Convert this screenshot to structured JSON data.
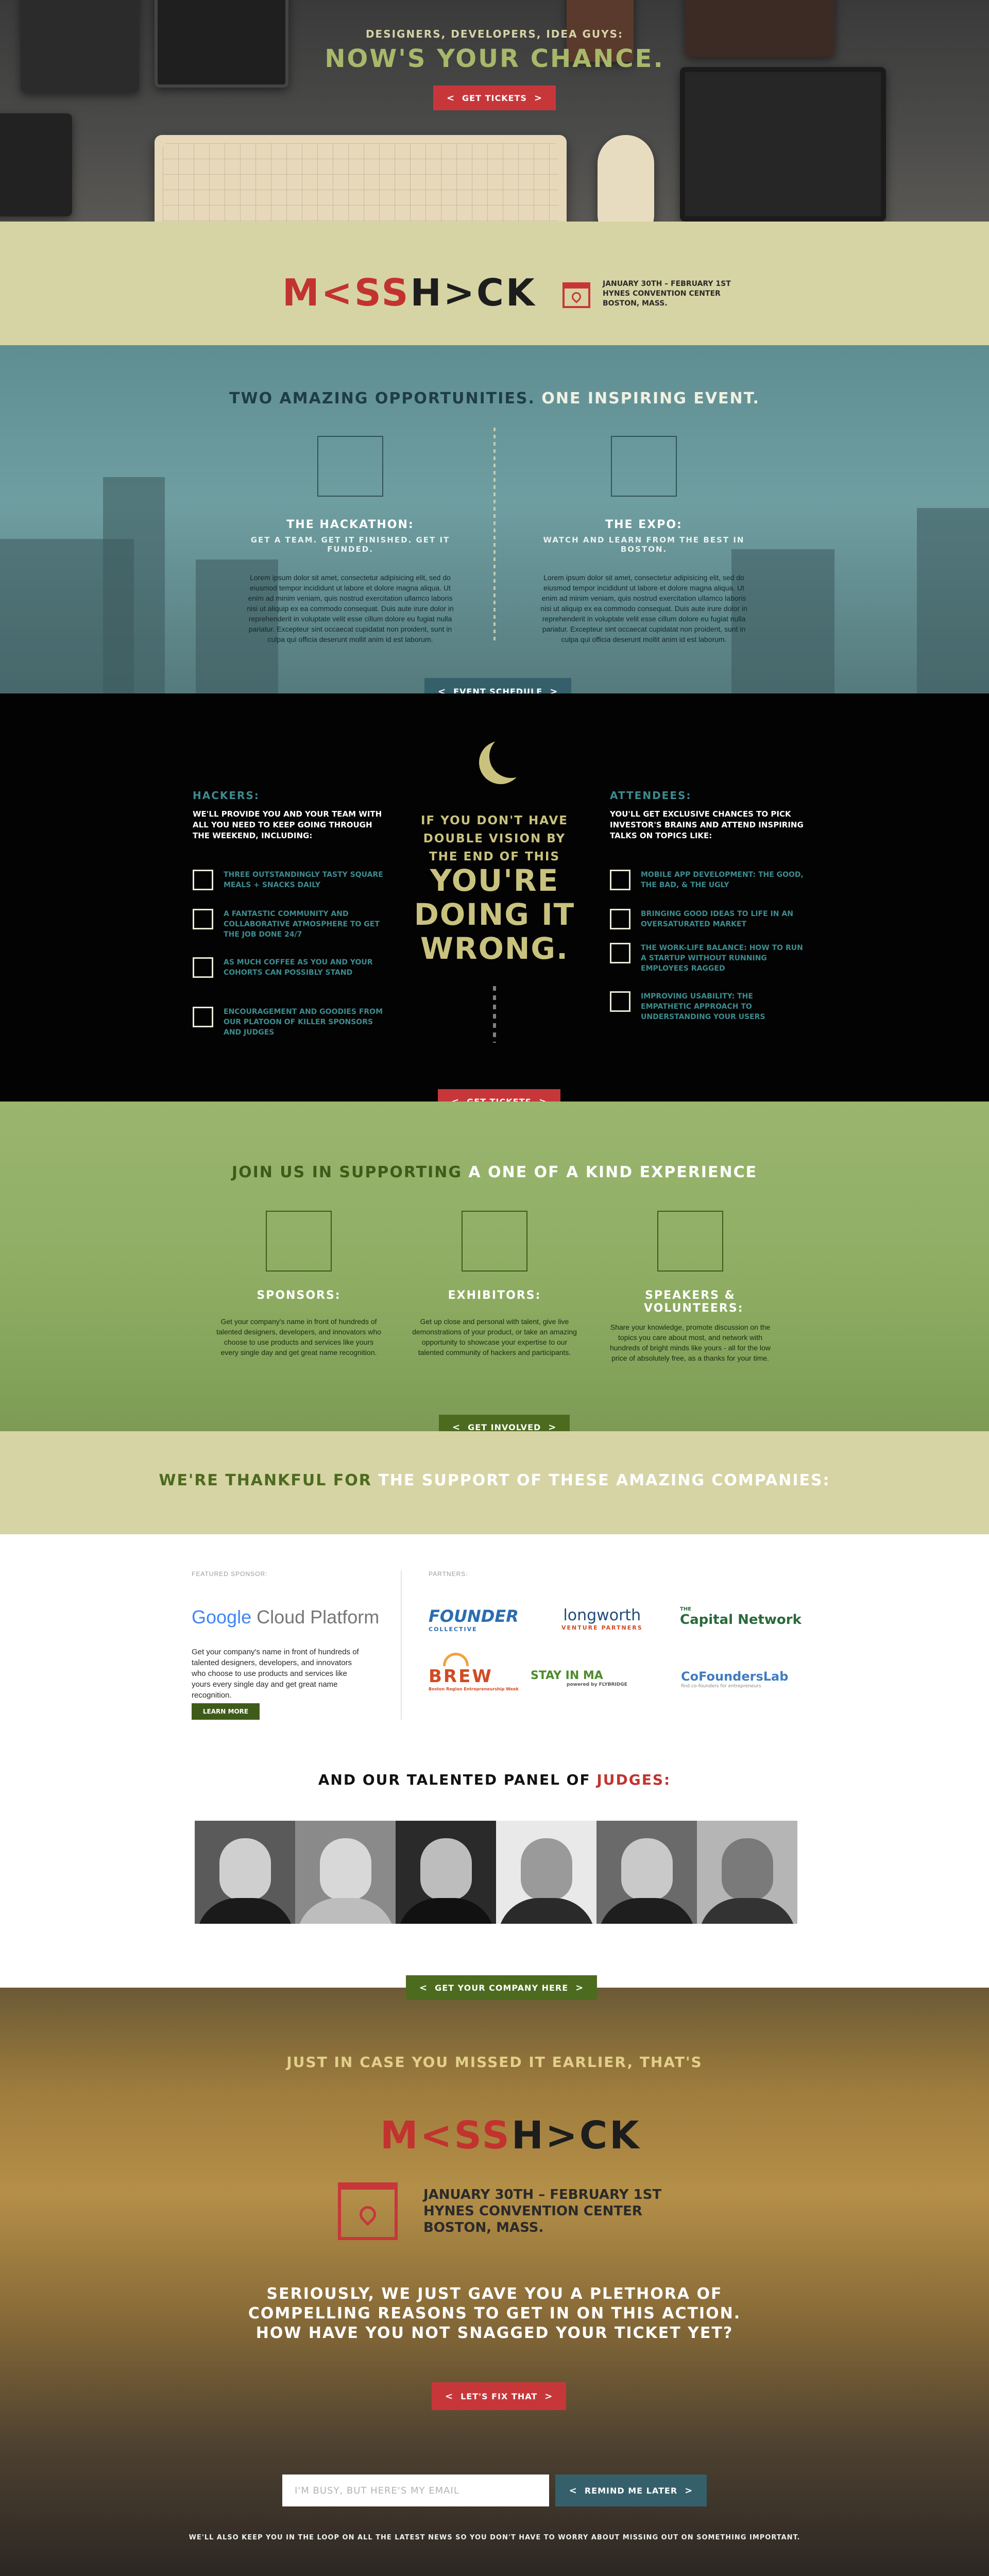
{
  "colors": {
    "red": "#c7373a",
    "teal": "#35606b",
    "green": "#4d6b1f",
    "khaki": "#d6d4a4",
    "gold": "#c9c27e"
  },
  "hero": {
    "subtitle": "DESIGNERS, DEVELOPERS, IDEA GUYS:",
    "title": "NOW'S YOUR CHANCE.",
    "cta": "GET TICKETS"
  },
  "brand": {
    "logo_left": "M<SS",
    "logo_right": "H>CK",
    "date": "JANUARY 30TH – FEBRUARY 1ST",
    "venue": "HYNES CONVENTION CENTER",
    "city": "BOSTON, MASS.",
    "icon": "calendar-pin-icon"
  },
  "opportunities": {
    "title_left": "TWO AMAZING OPPORTUNITIES.",
    "title_right": "ONE INSPIRING EVENT.",
    "hackathon": {
      "title": "THE HACKATHON:",
      "subtitle": "GET A TEAM. GET IT FINISHED. GET IT FUNDED.",
      "body": "Lorem ipsum dolor sit amet, consectetur adipisicing elit, sed do eiusmod tempor incididunt ut labore et dolore magna aliqua. Ut enim ad minim veniam, quis nostrud exercitation ullamco laboris nisi ut aliquip ex ea commodo consequat. Duis aute irure dolor in reprehenderit in voluptate velit esse cillum dolore eu fugiat nulla pariatur. Excepteur sint occaecat cupidatat non proident, sunt in culpa qui officia deserunt mollit anim id est laborum."
    },
    "expo": {
      "title": "THE EXPO:",
      "subtitle": "WATCH AND LEARN FROM THE BEST IN BOSTON.",
      "body": "Lorem ipsum dolor sit amet, consectetur adipisicing elit, sed do eiusmod tempor incididunt ut labore et dolore magna aliqua. Ut enim ad minim veniam, quis nostrud exercitation ullamco laboris nisi ut aliquip ex ea commodo consequat. Duis aute irure dolor in reprehenderit in voluptate velit esse cillum dolore eu fugiat nulla pariatur. Excepteur sint occaecat cupidatat non proident, sunt in culpa qui officia deserunt mollit anim id est laborum."
    },
    "cta": "EVENT SCHEDULE"
  },
  "hackers": {
    "title": "HACKERS:",
    "intro": "WE'LL PROVIDE YOU AND YOUR TEAM WITH ALL YOU NEED TO KEEP GOING THROUGH THE WEEKEND, INCLUDING:",
    "items": [
      "THREE OUTSTANDINGLY TASTY SQUARE MEALS + SNACKS DAILY",
      "A FANTASTIC COMMUNITY AND COLLABORATIVE ATMOSPHERE TO GET THE JOB DONE 24/7",
      "AS MUCH COFFEE AS YOU AND YOUR COHORTS CAN POSSIBLY STAND",
      "ENCOURAGEMENT AND GOODIES FROM OUR PLATOON OF KILLER SPONSORS AND JUDGES"
    ]
  },
  "middle": {
    "small": "IF YOU DON'T HAVE DOUBLE VISION BY THE END OF THIS",
    "big": "YOU'RE DOING IT WRONG."
  },
  "attendees": {
    "title": "ATTENDEES:",
    "intro": "YOU'LL GET EXCLUSIVE CHANCES TO PICK INVESTOR'S BRAINS AND ATTEND INSPIRING TALKS ON TOPICS LIKE:",
    "items": [
      "MOBILE APP DEVELOPMENT: THE GOOD, THE BAD, & THE UGLY",
      "BRINGING GOOD IDEAS TO LIFE IN AN OVERSATURATED MARKET",
      "THE WORK-LIFE BALANCE: HOW TO RUN A STARTUP WITHOUT RUNNING EMPLOYEES RAGGED",
      "IMPROVING USABILITY: THE EMPATHETIC APPROACH TO UNDERSTANDING YOUR USERS"
    ]
  },
  "tickets_cta": "GET TICKETS",
  "support": {
    "title_left": "JOIN US IN SUPPORTING",
    "title_right": "A ONE OF A KIND EXPERIENCE",
    "sponsors": {
      "title": "SPONSORS:",
      "body": "Get your company's name in front of hundreds of talented designers, developers, and innovators who choose to use products and services like yours every single day and get great name recognition."
    },
    "exhibitors": {
      "title": "EXHIBITORS:",
      "body": "Get up close and personal with talent, give live demonstrations of your product, or take an amazing opportunity to showcase your expertise to our talented community of hackers and participants."
    },
    "speakers": {
      "title": "SPEAKERS & VOLUNTEERS:",
      "body": "Share your knowledge, promote discussion on the topics you care about most, and network with hundreds of bright minds like yours - all for the low price of absolutely free, as a thanks for your time."
    },
    "cta": "GET INVOLVED"
  },
  "thanks": {
    "left": "WE'RE THANKFUL FOR",
    "right": "THE SUPPORT OF THESE AMAZING COMPANIES:"
  },
  "sponsor_section": {
    "featured_label": "FEATURED SPONSOR:",
    "partners_label": "PARTNERS:",
    "google": "Google",
    "cloud": "Cloud Platform",
    "featured_desc": "Get your company's name in front of hundreds of talented designers, developers, and innovators who choose to use products and services like yours every single day and get great name recognition.",
    "learn_more": "LEARN MORE",
    "partners": [
      {
        "name": "FOUNDER",
        "sub": "COLLECTIVE",
        "color": "#2b6cb0"
      },
      {
        "name": "longworth",
        "sub": "VENTURE PARTNERS",
        "color": "#1f4a7a"
      },
      {
        "name": "Capital Network",
        "sub": "THE",
        "color": "#2a6a3c"
      },
      {
        "name": "BREW",
        "sub": "Boston Region Entrepreneurship Week",
        "color": "#d24a23"
      },
      {
        "name": "STAY IN MA",
        "sub": "powered by FLYBRIDGE",
        "color": "#4f8b2c"
      },
      {
        "name": "CoFoundersLab",
        "sub": "find co-founders for entrepreneurs",
        "color": "#3f7cc3"
      }
    ]
  },
  "judges": {
    "left": "AND OUR TALENTED PANEL OF",
    "right": "JUDGES:",
    "cta": "GET YOUR COMPANY HERE"
  },
  "final": {
    "sub": "JUST IN CASE YOU MISSED IT EARLIER, THAT'S",
    "question": "SERIOUSLY, WE JUST GAVE YOU A PLETHORA OF COMPELLING REASONS TO GET IN ON THIS ACTION. HOW HAVE YOU NOT SNAGGED YOUR TICKET YET?",
    "cta": "LET'S FIX THAT",
    "email_placeholder": "I'M BUSY, BUT HERE'S MY EMAIL",
    "remind": "REMIND ME LATER",
    "footnote": "WE'LL ALSO KEEP YOU IN THE LOOP ON ALL THE LATEST NEWS SO YOU DON'T HAVE TO WORRY ABOUT MISSING OUT ON SOMETHING IMPORTANT."
  }
}
